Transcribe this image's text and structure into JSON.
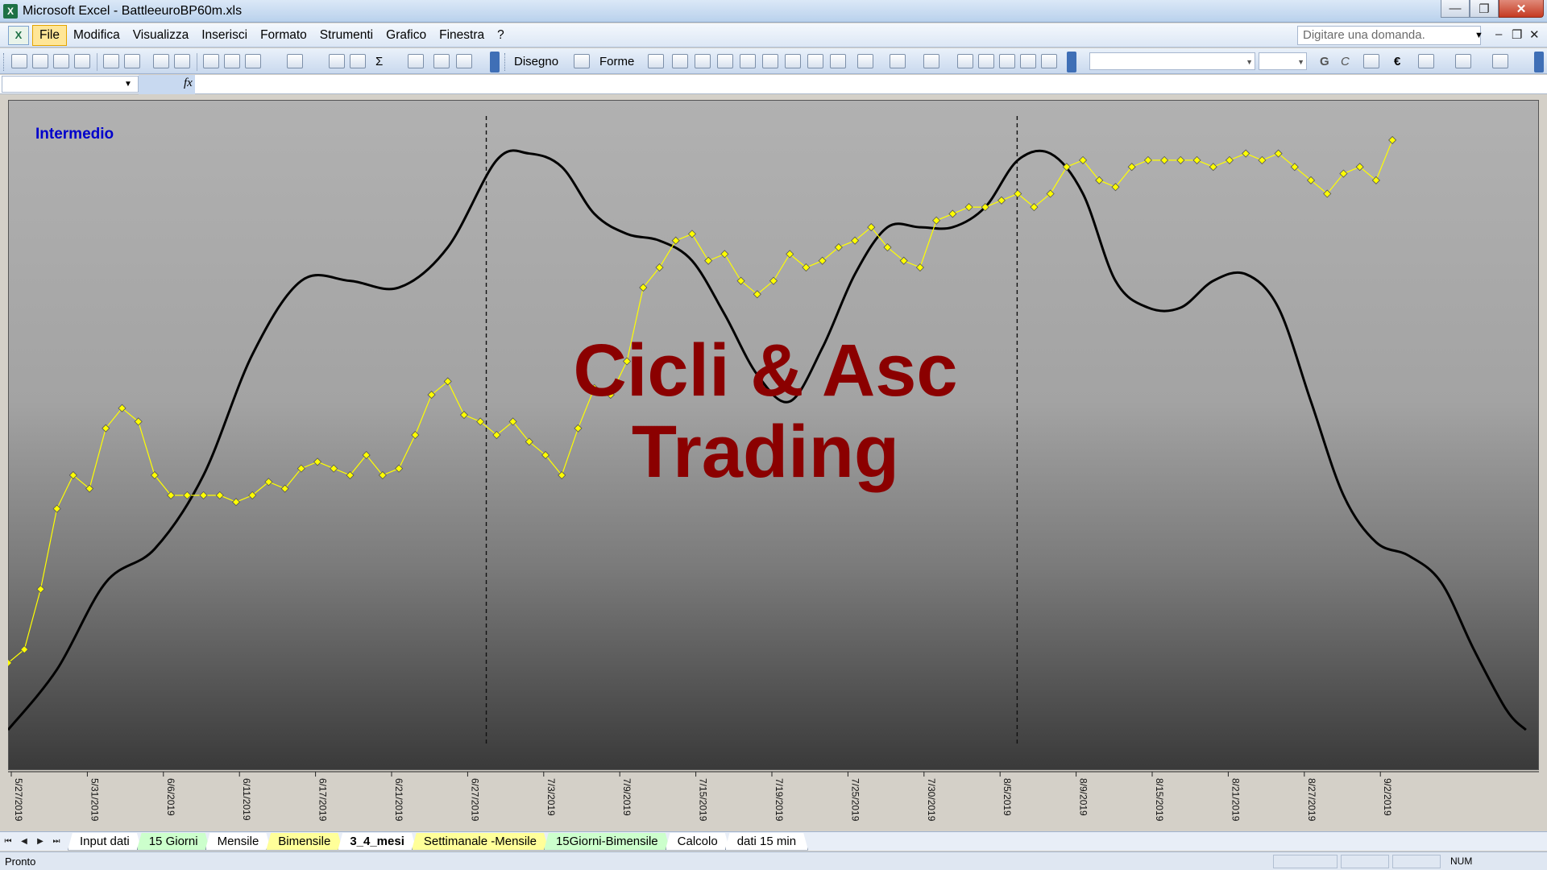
{
  "window": {
    "app_title": "Microsoft Excel - BattleeuroBP60m.xls",
    "app_icon": "excel-icon",
    "controls": [
      "minimize",
      "restore",
      "close"
    ]
  },
  "menu": {
    "items": [
      "File",
      "Modifica",
      "Visualizza",
      "Inserisci",
      "Formato",
      "Strumenti",
      "Grafico",
      "Finestra",
      "?"
    ],
    "help_placeholder": "Digitare una domanda."
  },
  "toolbar": {
    "drawing_label": "Disegno",
    "shapes_label": "Forme",
    "sum_symbol": "Σ",
    "bold_letter": "G",
    "italic_letter": "C",
    "euro_symbol": "€"
  },
  "formula_bar": {
    "name_box": "",
    "fx_label": "fx"
  },
  "chart": {
    "watermark_line1": "Cicli & Asc",
    "watermark_line2": "Trading",
    "label_intermedio": "Intermedio",
    "accent_color": "#8b0000",
    "price_color": "#ffff00",
    "cycle_color": "#000000",
    "label_color": "#0000cc"
  },
  "chart_data": {
    "type": "line",
    "x_labels": [
      "5/27/2019",
      "5/31/2019",
      "6/6/2019",
      "6/11/2019",
      "6/17/2019",
      "6/21/2019",
      "6/27/2019",
      "7/3/2019",
      "7/9/2019",
      "7/15/2019",
      "7/19/2019",
      "7/25/2019",
      "7/30/2019",
      "8/5/2019",
      "8/9/2019",
      "8/15/2019",
      "8/21/2019",
      "8/27/2019",
      "9/2/2019"
    ],
    "vertical_markers": [
      "6/30/2019",
      "8/7/2019"
    ],
    "series": [
      {
        "style": "yellow-diamond-markers",
        "points": [
          {
            "x": 0.0,
            "y": 16
          },
          {
            "x": 0.5,
            "y": 18
          },
          {
            "x": 1.0,
            "y": 27
          },
          {
            "x": 1.5,
            "y": 39
          },
          {
            "x": 2.0,
            "y": 44
          },
          {
            "x": 2.5,
            "y": 42
          },
          {
            "x": 3.0,
            "y": 51
          },
          {
            "x": 3.5,
            "y": 54
          },
          {
            "x": 4.0,
            "y": 52
          },
          {
            "x": 4.5,
            "y": 44
          },
          {
            "x": 5.0,
            "y": 41
          },
          {
            "x": 5.5,
            "y": 41
          },
          {
            "x": 6.0,
            "y": 41
          },
          {
            "x": 6.5,
            "y": 41
          },
          {
            "x": 7.0,
            "y": 40
          },
          {
            "x": 7.5,
            "y": 41
          },
          {
            "x": 8.0,
            "y": 43
          },
          {
            "x": 8.5,
            "y": 42
          },
          {
            "x": 9.0,
            "y": 45
          },
          {
            "x": 9.5,
            "y": 46
          },
          {
            "x": 10.0,
            "y": 45
          },
          {
            "x": 10.5,
            "y": 44
          },
          {
            "x": 11.0,
            "y": 47
          },
          {
            "x": 11.5,
            "y": 44
          },
          {
            "x": 12.0,
            "y": 45
          },
          {
            "x": 12.5,
            "y": 50
          },
          {
            "x": 13.0,
            "y": 56
          },
          {
            "x": 13.5,
            "y": 58
          },
          {
            "x": 14.0,
            "y": 53
          },
          {
            "x": 14.5,
            "y": 52
          },
          {
            "x": 15.0,
            "y": 50
          },
          {
            "x": 15.5,
            "y": 52
          },
          {
            "x": 16.0,
            "y": 49
          },
          {
            "x": 16.5,
            "y": 47
          },
          {
            "x": 17.0,
            "y": 44
          },
          {
            "x": 17.5,
            "y": 51
          },
          {
            "x": 18.0,
            "y": 57
          },
          {
            "x": 18.5,
            "y": 56
          },
          {
            "x": 19.0,
            "y": 61
          },
          {
            "x": 19.5,
            "y": 72
          },
          {
            "x": 20.0,
            "y": 75
          },
          {
            "x": 20.5,
            "y": 79
          },
          {
            "x": 21.0,
            "y": 80
          },
          {
            "x": 21.5,
            "y": 76
          },
          {
            "x": 22.0,
            "y": 77
          },
          {
            "x": 22.5,
            "y": 73
          },
          {
            "x": 23.0,
            "y": 71
          },
          {
            "x": 23.5,
            "y": 73
          },
          {
            "x": 24.0,
            "y": 77
          },
          {
            "x": 24.5,
            "y": 75
          },
          {
            "x": 25.0,
            "y": 76
          },
          {
            "x": 25.5,
            "y": 78
          },
          {
            "x": 26.0,
            "y": 79
          },
          {
            "x": 26.5,
            "y": 81
          },
          {
            "x": 27.0,
            "y": 78
          },
          {
            "x": 27.5,
            "y": 76
          },
          {
            "x": 28.0,
            "y": 75
          },
          {
            "x": 28.5,
            "y": 82
          },
          {
            "x": 29.0,
            "y": 83
          },
          {
            "x": 29.5,
            "y": 84
          },
          {
            "x": 30.0,
            "y": 84
          },
          {
            "x": 30.5,
            "y": 85
          },
          {
            "x": 31.0,
            "y": 86
          },
          {
            "x": 31.5,
            "y": 84
          },
          {
            "x": 32.0,
            "y": 86
          },
          {
            "x": 32.5,
            "y": 90
          },
          {
            "x": 33.0,
            "y": 91
          },
          {
            "x": 33.5,
            "y": 88
          },
          {
            "x": 34.0,
            "y": 87
          },
          {
            "x": 34.5,
            "y": 90
          },
          {
            "x": 35.0,
            "y": 91
          },
          {
            "x": 35.5,
            "y": 91
          },
          {
            "x": 36.0,
            "y": 91
          },
          {
            "x": 36.5,
            "y": 91
          },
          {
            "x": 37.0,
            "y": 90
          },
          {
            "x": 37.5,
            "y": 91
          },
          {
            "x": 38.0,
            "y": 92
          },
          {
            "x": 38.5,
            "y": 91
          },
          {
            "x": 39.0,
            "y": 92
          },
          {
            "x": 39.5,
            "y": 90
          },
          {
            "x": 40.0,
            "y": 88
          },
          {
            "x": 40.5,
            "y": 86
          },
          {
            "x": 41.0,
            "y": 89
          },
          {
            "x": 41.5,
            "y": 90
          },
          {
            "x": 42.0,
            "y": 88
          },
          {
            "x": 42.5,
            "y": 94
          }
        ]
      },
      {
        "style": "black-line",
        "points": [
          {
            "x": 0.0,
            "y": 6
          },
          {
            "x": 1.5,
            "y": 15
          },
          {
            "x": 3.0,
            "y": 28
          },
          {
            "x": 4.5,
            "y": 33
          },
          {
            "x": 6.0,
            "y": 44
          },
          {
            "x": 7.5,
            "y": 62
          },
          {
            "x": 9.0,
            "y": 73
          },
          {
            "x": 10.5,
            "y": 73
          },
          {
            "x": 12.0,
            "y": 72
          },
          {
            "x": 13.5,
            "y": 78
          },
          {
            "x": 15.0,
            "y": 91
          },
          {
            "x": 16.0,
            "y": 92
          },
          {
            "x": 17.0,
            "y": 90
          },
          {
            "x": 18.0,
            "y": 83
          },
          {
            "x": 19.0,
            "y": 80
          },
          {
            "x": 20.0,
            "y": 79
          },
          {
            "x": 21.0,
            "y": 76
          },
          {
            "x": 22.0,
            "y": 68
          },
          {
            "x": 23.0,
            "y": 59
          },
          {
            "x": 24.0,
            "y": 55
          },
          {
            "x": 25.0,
            "y": 63
          },
          {
            "x": 26.0,
            "y": 74
          },
          {
            "x": 27.0,
            "y": 81
          },
          {
            "x": 28.0,
            "y": 81
          },
          {
            "x": 29.0,
            "y": 81
          },
          {
            "x": 30.0,
            "y": 84
          },
          {
            "x": 31.0,
            "y": 91
          },
          {
            "x": 32.0,
            "y": 92
          },
          {
            "x": 33.0,
            "y": 86
          },
          {
            "x": 34.0,
            "y": 73
          },
          {
            "x": 35.0,
            "y": 69
          },
          {
            "x": 36.0,
            "y": 69
          },
          {
            "x": 37.0,
            "y": 73
          },
          {
            "x": 38.0,
            "y": 74
          },
          {
            "x": 39.0,
            "y": 69
          },
          {
            "x": 40.0,
            "y": 55
          },
          {
            "x": 41.0,
            "y": 41
          },
          {
            "x": 42.0,
            "y": 34
          },
          {
            "x": 43.0,
            "y": 32
          },
          {
            "x": 44.0,
            "y": 28
          },
          {
            "x": 45.0,
            "y": 18
          },
          {
            "x": 46.0,
            "y": 9
          },
          {
            "x": 46.6,
            "y": 6
          }
        ]
      }
    ],
    "ylim": [
      0,
      100
    ],
    "xlim": [
      0,
      47
    ],
    "grid": false,
    "legend": "none"
  },
  "sheet_tabs": [
    {
      "label": "Input dati",
      "color": "white"
    },
    {
      "label": "15 Giorni",
      "color": "green"
    },
    {
      "label": "Mensile",
      "color": "white"
    },
    {
      "label": "Bimensile",
      "color": "yellow"
    },
    {
      "label": "3_4_mesi",
      "color": "active"
    },
    {
      "label": "Settimanale -Mensile",
      "color": "yellow"
    },
    {
      "label": "15Giorni-Bimensile",
      "color": "green"
    },
    {
      "label": "Calcolo",
      "color": "white"
    },
    {
      "label": "dati 15 min",
      "color": "white"
    }
  ],
  "status": {
    "left": "Pronto",
    "num": "NUM"
  }
}
